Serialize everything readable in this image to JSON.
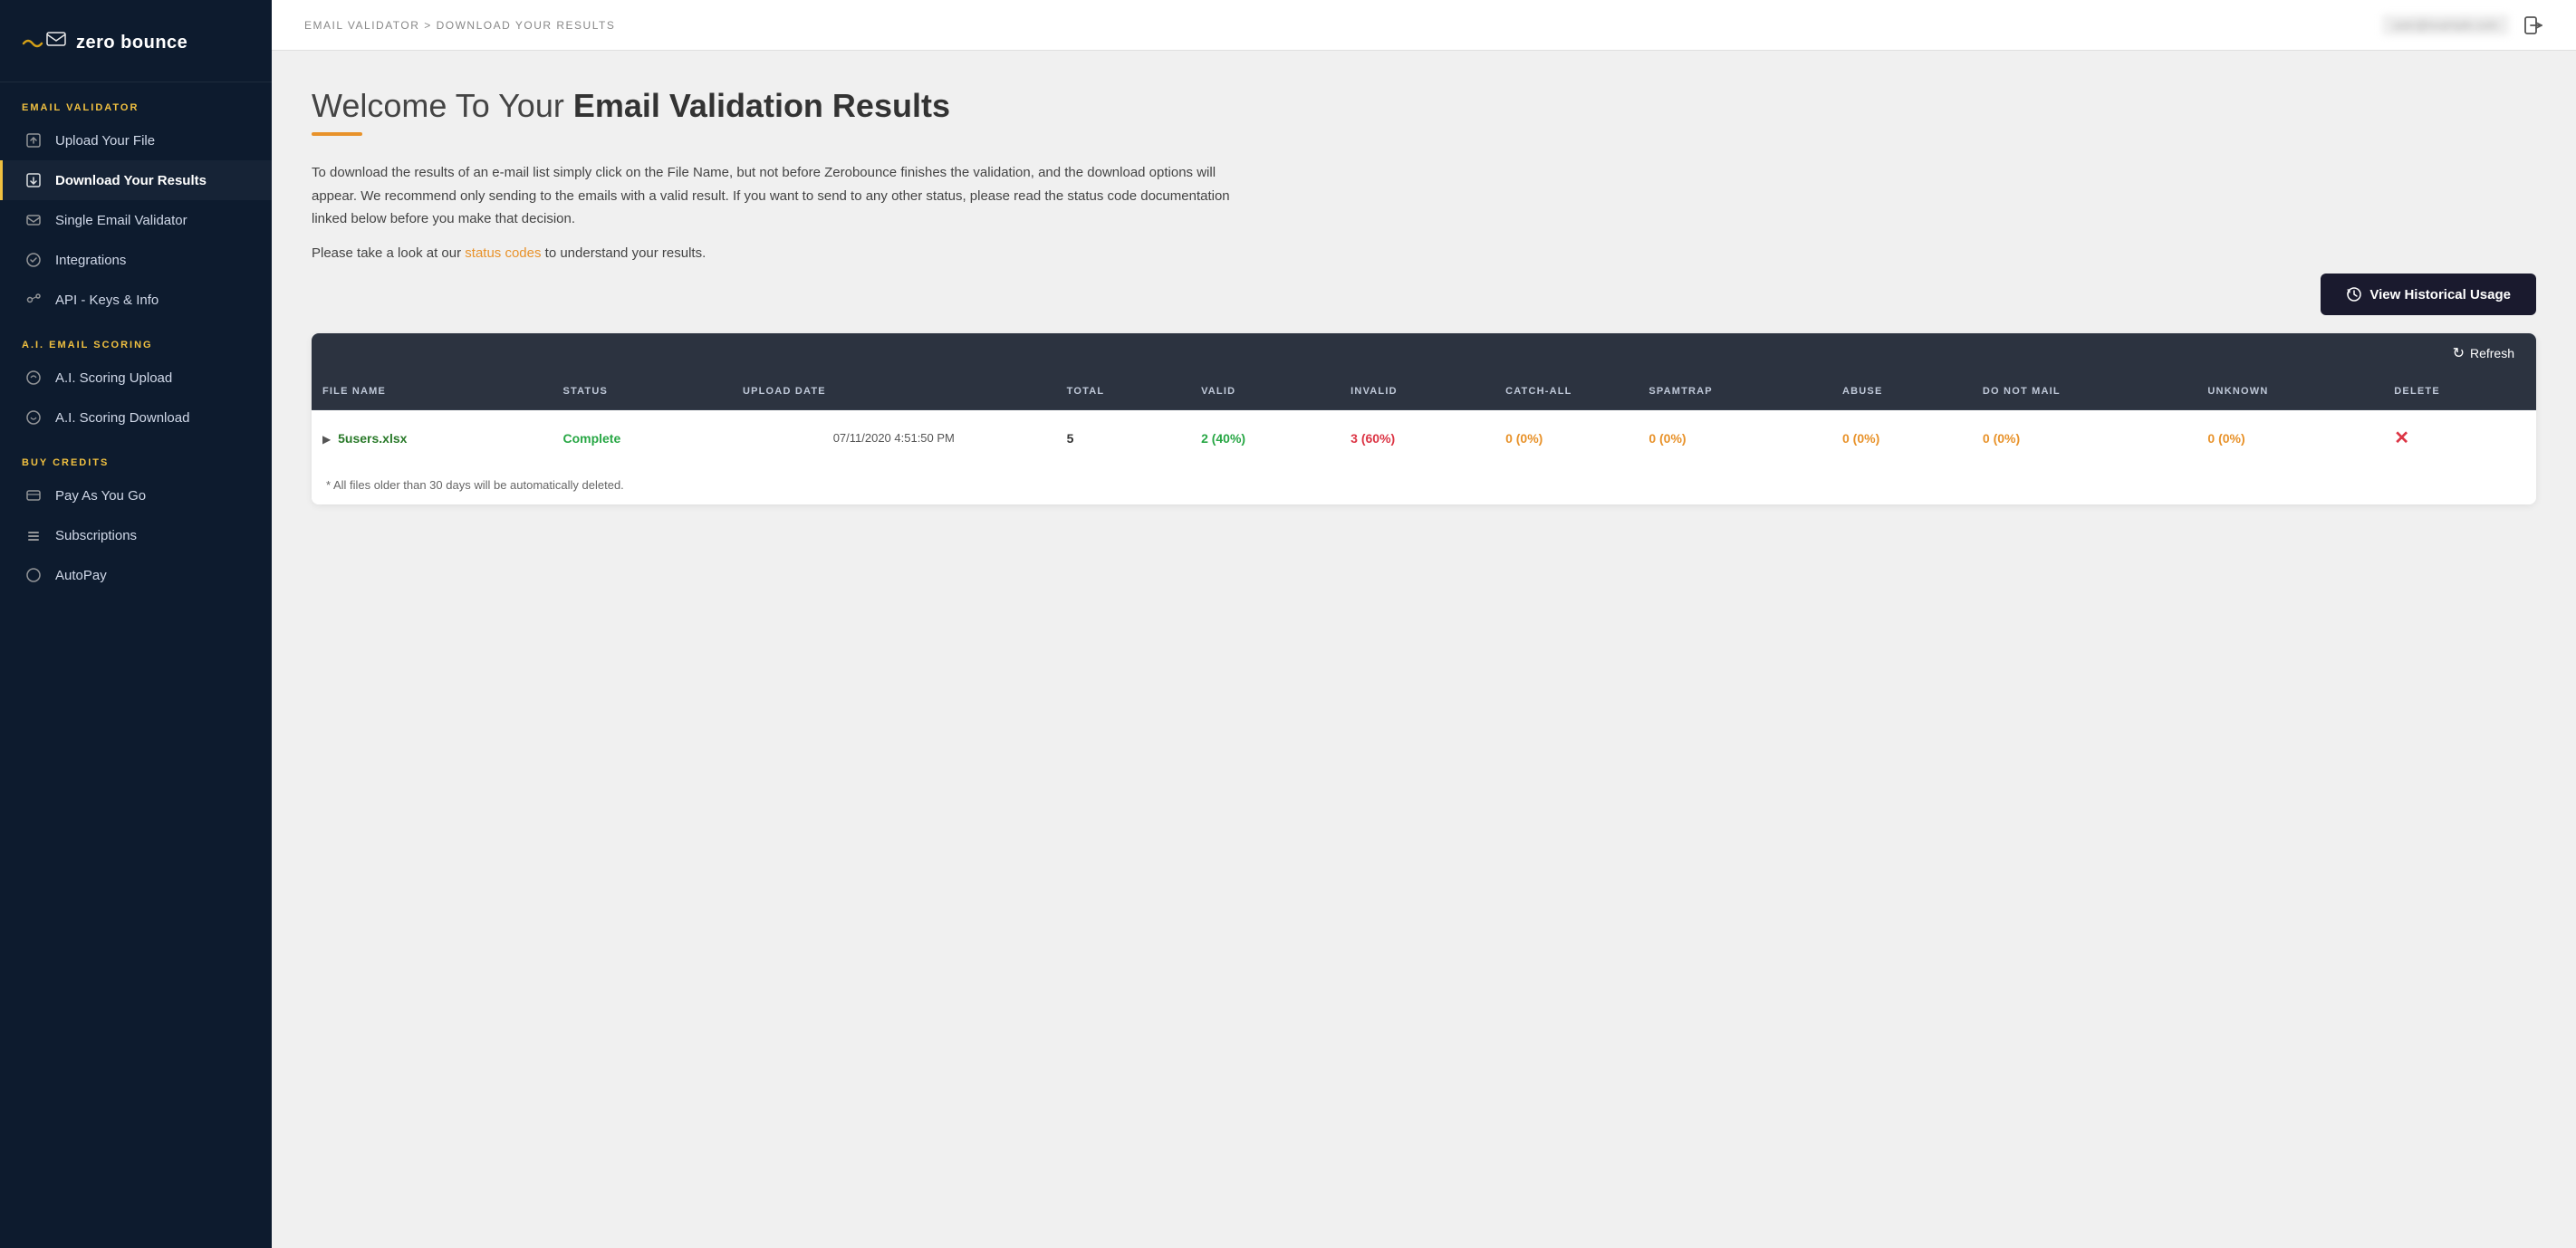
{
  "sidebar": {
    "logo": {
      "icon": "〜✉",
      "brand": "zero bounce"
    },
    "sections": [
      {
        "label": "EMAIL VALIDATOR",
        "items": [
          {
            "id": "upload",
            "icon": "⬆",
            "label": "Upload Your File",
            "active": false
          },
          {
            "id": "download",
            "icon": "⬇",
            "label": "Download Your Results",
            "active": true
          },
          {
            "id": "single",
            "icon": "✉",
            "label": "Single Email Validator",
            "active": false
          },
          {
            "id": "integrations",
            "icon": "✓",
            "label": "Integrations",
            "active": false
          },
          {
            "id": "api",
            "icon": "🔑",
            "label": "API - Keys & Info",
            "active": false
          }
        ]
      },
      {
        "label": "A.I. EMAIL SCORING",
        "items": [
          {
            "id": "ai-upload",
            "icon": "⭐",
            "label": "A.I. Scoring Upload",
            "active": false
          },
          {
            "id": "ai-download",
            "icon": "⭐",
            "label": "A.I. Scoring Download",
            "active": false
          }
        ]
      },
      {
        "label": "BUY CREDITS",
        "items": [
          {
            "id": "payasyougo",
            "icon": "💳",
            "label": "Pay As You Go",
            "active": false
          },
          {
            "id": "subscriptions",
            "icon": "📦",
            "label": "Subscriptions",
            "active": false
          },
          {
            "id": "autopay",
            "icon": "○",
            "label": "AutoPay",
            "active": false
          }
        ]
      }
    ]
  },
  "topbar": {
    "breadcrumb": "EMAIL VALIDATOR > DOWNLOAD YOUR RESULTS",
    "user_blurred": "user@example.com",
    "logout_label": "logout"
  },
  "main": {
    "title_prefix": "Welcome To Your ",
    "title_bold": "Email Validation Results",
    "description1": "To download the results of an e-mail list simply click on the File Name, but not before Zerobounce finishes the validation, and the download options will appear. We recommend only sending to the emails with a valid result. If you want to send to any other status, please read the status code documentation linked below before you make that decision.",
    "description2_prefix": "Please take a look at our ",
    "status_codes_link": "status codes",
    "description2_suffix": " to understand your results.",
    "btn_historical": "View Historical Usage",
    "refresh_label": "Refresh",
    "table": {
      "columns": [
        "FILE NAME",
        "STATUS",
        "UPLOAD DATE",
        "TOTAL",
        "VALID",
        "INVALID",
        "CATCH-ALL",
        "SPAMTRAP",
        "ABUSE",
        "DO NOT MAIL",
        "UNKNOWN",
        "DELETE"
      ],
      "rows": [
        {
          "file_name": "5users.xlsx",
          "status": "Complete",
          "upload_date": "07/11/2020 4:51:50 PM",
          "total": "5",
          "valid": "2 (40%)",
          "invalid": "3 (60%)",
          "catch_all": "0 (0%)",
          "spamtrap": "0 (0%)",
          "abuse": "0 (0%)",
          "do_not_mail": "0 (0%)",
          "unknown": "0 (0%)",
          "delete": "✕"
        }
      ],
      "footnote": "* All files older than 30 days will be automatically deleted."
    }
  }
}
